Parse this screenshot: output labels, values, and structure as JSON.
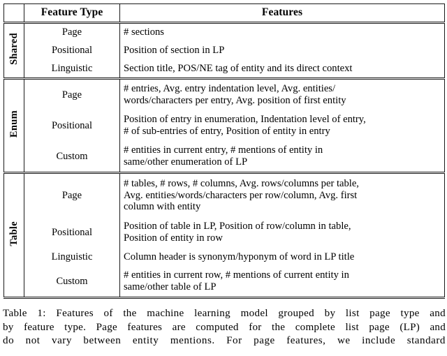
{
  "table": {
    "columns": {
      "group_header": "",
      "feature_type_header": "Feature Type",
      "features_header": "Features"
    },
    "groups": [
      {
        "label": "Shared",
        "rows": [
          {
            "type": "Page",
            "features": "# sections"
          },
          {
            "type": "Positional",
            "features": "Position of section in LP"
          },
          {
            "type": "Linguistic",
            "features": "Section title, POS/NE tag of entity and its direct context"
          }
        ]
      },
      {
        "label": "Enum",
        "rows": [
          {
            "type": "Page",
            "features": "# entries, Avg. entry indentation level, Avg. entities/\nwords/characters per entry, Avg. position of first entity"
          },
          {
            "type": "Positional",
            "features": "Position of entry in enumeration, Indentation level of entry,\n# of sub-entries of entry, Position of entity in entry"
          },
          {
            "type": "Custom",
            "features": "# entities in current entry, # mentions of entity in\nsame/other enumeration of LP"
          }
        ]
      },
      {
        "label": "Table",
        "rows": [
          {
            "type": "Page",
            "features": "# tables, # rows, # columns, Avg. rows/columns per table,\nAvg. entities/words/characters per row/column, Avg. first\ncolumn with entity"
          },
          {
            "type": "Positional",
            "features": "Position of table in LP, Position of row/column in table,\nPosition of entity in row"
          },
          {
            "type": "Linguistic",
            "features": "Column header is synonym/hyponym of word in LP title"
          },
          {
            "type": "Custom",
            "features": "# entities in current row, # mentions of current entity in\nsame/other table of LP"
          }
        ]
      }
    ]
  },
  "caption": {
    "line1": "Table 1: Features of the machine learning model grouped by list page type and",
    "line2": "by feature type. Page features are computed for the complete list page (LP) and",
    "line3": "do not vary between entity mentions. For page features, we include standard"
  }
}
